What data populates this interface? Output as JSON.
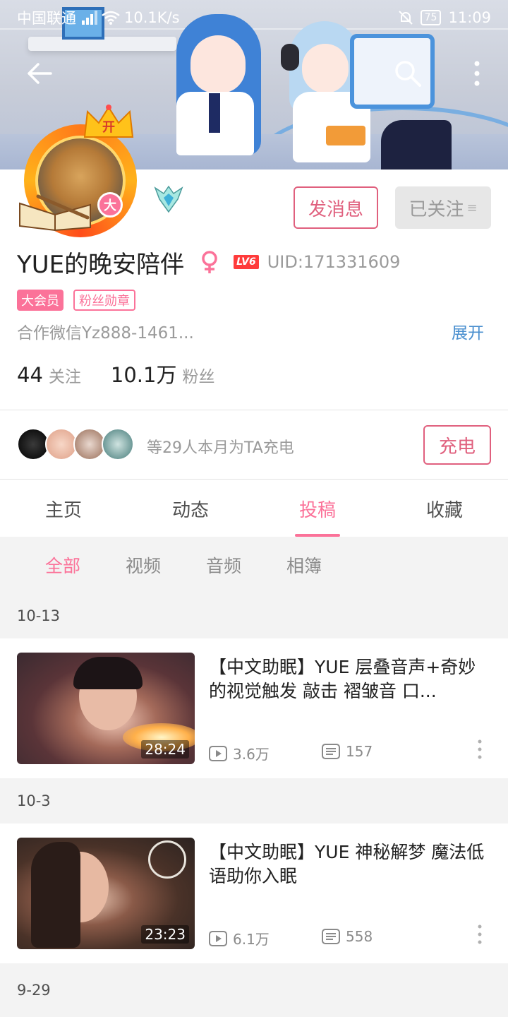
{
  "status_bar": {
    "carrier": "中国联通",
    "speed": "10.1K/s",
    "battery": "75",
    "time": "11:09"
  },
  "profile": {
    "vip_badge": "大",
    "crown_text": "开",
    "message_button": "发消息",
    "followed_button": "已关注",
    "name": "YUE的晚安陪伴",
    "level": "LV6",
    "uid": "UID:171331609",
    "tags": [
      "大会员",
      "粉丝勋章"
    ],
    "bio": "合作微信Yz888-1461...",
    "expand": "展开",
    "following_count": "44",
    "following_label": "关注",
    "followers_count": "10.1万",
    "followers_label": "粉丝"
  },
  "charge": {
    "text": "等29人本月为TA充电",
    "button": "充电"
  },
  "tabs": [
    "主页",
    "动态",
    "投稿",
    "收藏"
  ],
  "active_tab": "投稿",
  "subtabs": [
    "全部",
    "视频",
    "音频",
    "相簿"
  ],
  "active_subtab": "全部",
  "videos": [
    {
      "date": "10-13",
      "title": "【中文助眠】YUE 层叠音声+奇妙的视觉触发 敲击 褶皱音 口...",
      "duration": "28:24",
      "plays": "3.6万",
      "comments": "157"
    },
    {
      "date": "10-3",
      "title": "【中文助眠】YUE 神秘解梦 魔法低语助你入眠",
      "duration": "23:23",
      "plays": "6.1万",
      "comments": "558"
    }
  ],
  "next_date": "9-29",
  "colors": {
    "accent": "#fb7299",
    "link": "#4a8fcf",
    "button_border": "#e0607e"
  }
}
